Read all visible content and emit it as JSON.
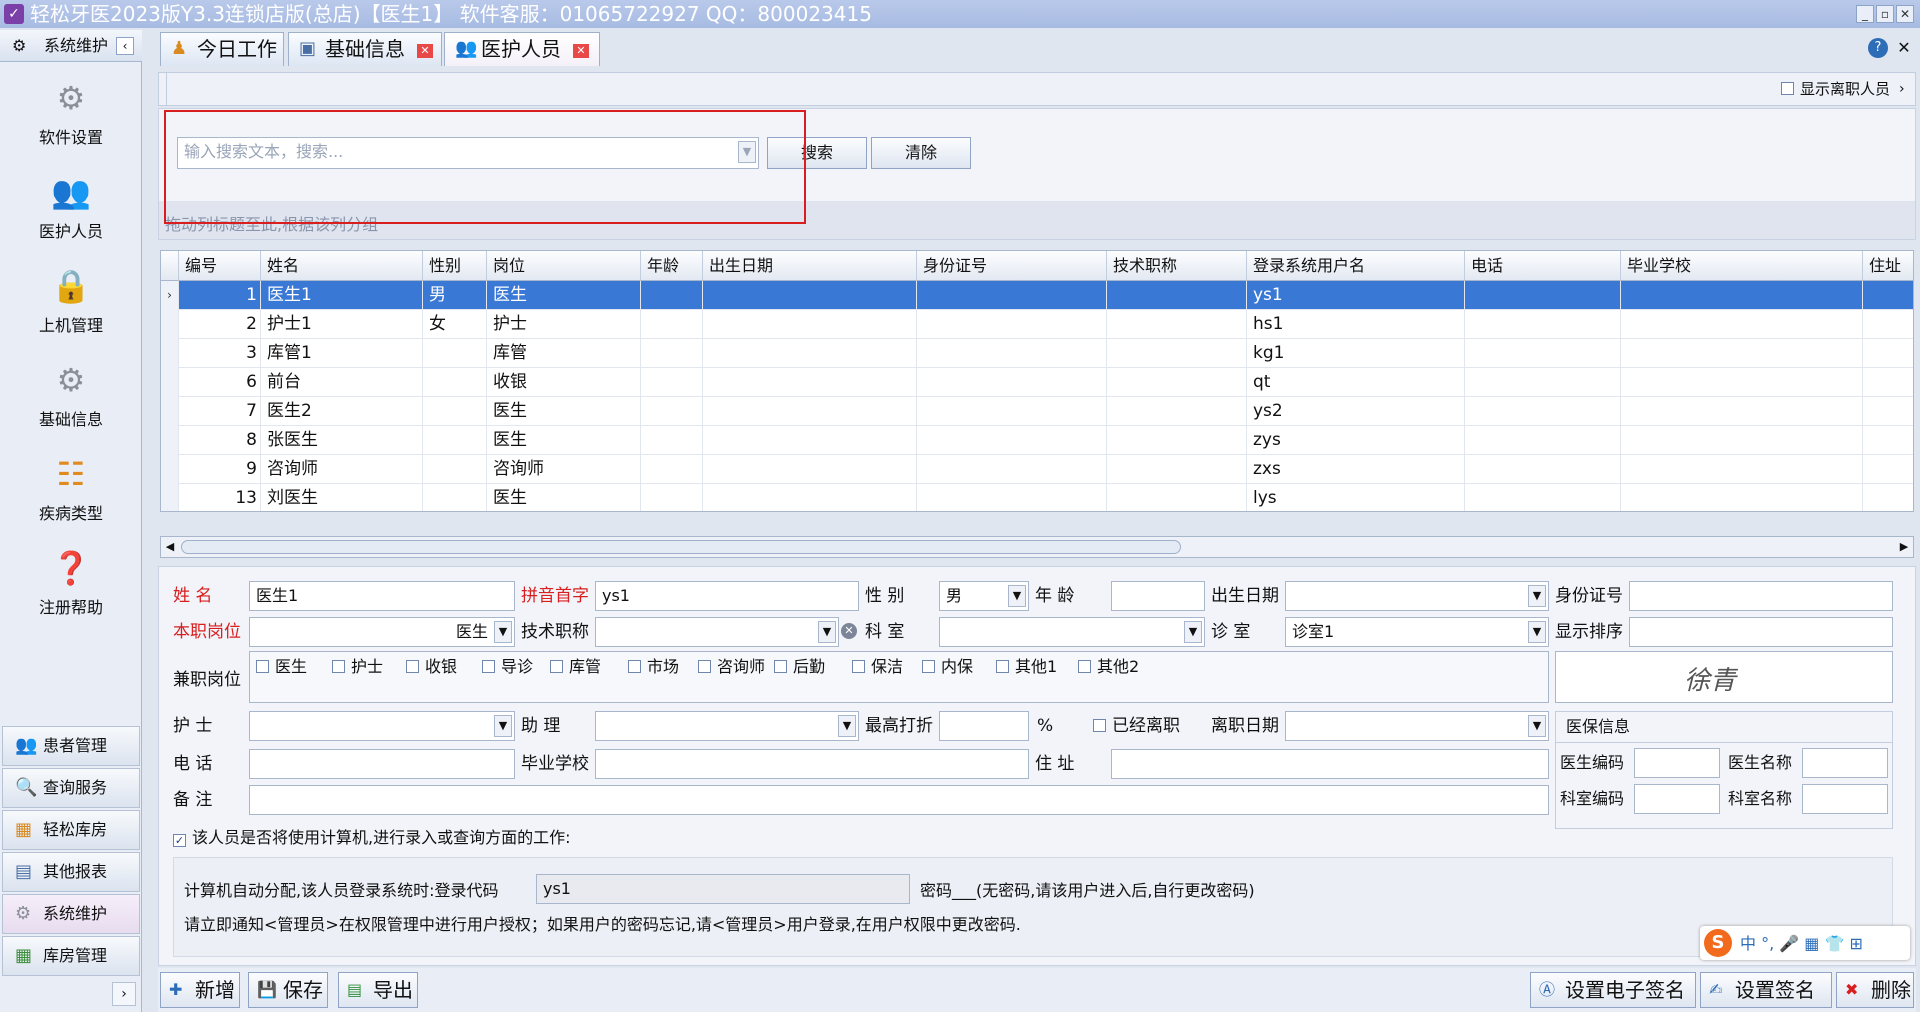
{
  "window": {
    "title": "轻松牙医2023版Y3.3连锁店版(总店)【医生1】    软件客服：01065722927 QQ：800023415"
  },
  "sidebar": {
    "header": "系统维护",
    "items": [
      {
        "label": "软件设置",
        "icon": "gear-icon"
      },
      {
        "label": "医护人员",
        "icon": "staff-icon"
      },
      {
        "label": "上机管理",
        "icon": "lock-icon"
      },
      {
        "label": "基础信息",
        "icon": "document-gear-icon"
      },
      {
        "label": "疾病类型",
        "icon": "tree-icon"
      },
      {
        "label": "注册帮助",
        "icon": "help-icon"
      }
    ],
    "nav": [
      {
        "label": "患者管理"
      },
      {
        "label": "查询服务"
      },
      {
        "label": "轻松库房"
      },
      {
        "label": "其他报表"
      },
      {
        "label": "系统维护"
      },
      {
        "label": "库房管理"
      }
    ]
  },
  "tabs": [
    {
      "label": "今日工作"
    },
    {
      "label": "基础信息"
    },
    {
      "label": "医护人员"
    }
  ],
  "toolbar": {
    "show_resigned": "显示离职人员"
  },
  "search": {
    "placeholder": "输入搜索文本，搜索...",
    "search_label": "搜索",
    "clear_label": "清除",
    "group_hint": "拖动列标题至此,根据该列分组"
  },
  "grid": {
    "columns": [
      "编号",
      "姓名",
      "性别",
      "岗位",
      "年龄",
      "出生日期",
      "身份证号",
      "技术职称",
      "登录系统用户名",
      "电话",
      "毕业学校",
      "住址"
    ],
    "rows": [
      {
        "id": "1",
        "name": "医生1",
        "gender": "男",
        "post": "医生",
        "login": "ys1"
      },
      {
        "id": "2",
        "name": "护士1",
        "gender": "女",
        "post": "护士",
        "login": "hs1"
      },
      {
        "id": "3",
        "name": "库管1",
        "gender": "",
        "post": "库管",
        "login": "kg1"
      },
      {
        "id": "6",
        "name": "前台",
        "gender": "",
        "post": "收银",
        "login": "qt"
      },
      {
        "id": "7",
        "name": "医生2",
        "gender": "",
        "post": "医生",
        "login": "ys2"
      },
      {
        "id": "8",
        "name": "张医生",
        "gender": "",
        "post": "医生",
        "login": "zys"
      },
      {
        "id": "9",
        "name": "咨询师",
        "gender": "",
        "post": "咨询师",
        "login": "zxs"
      },
      {
        "id": "13",
        "name": "刘医生",
        "gender": "",
        "post": "医生",
        "login": "lys"
      }
    ]
  },
  "form": {
    "name_label": "姓  名",
    "name_value": "医生1",
    "pinyin_label": "拼音首字",
    "pinyin_value": "ys1",
    "gender_label": "性  别",
    "gender_value": "男",
    "age_label": "年  龄",
    "birth_label": "出生日期",
    "idcard_label": "身份证号",
    "post_label": "本职岗位",
    "post_value": "医生",
    "title_label": "技术职称",
    "dept_label": "科  室",
    "room_label": "诊  室",
    "room_value": "诊室1",
    "order_label": "显示排序",
    "parttime_label": "兼职岗位",
    "parttime_options": [
      "医生",
      "护士",
      "收银",
      "导诊",
      "库管",
      "市场",
      "咨询师",
      "后勤",
      "保洁",
      "内保",
      "其他1",
      "其他2"
    ],
    "signature": "徐青",
    "nurse_label": "护  士",
    "assistant_label": "助  理",
    "discount_label": "最高打折",
    "percent": "%",
    "resigned_label": "已经离职",
    "resign_date_label": "离职日期",
    "insurance_label": "医保信息",
    "phone_label": "电  话",
    "school_label": "毕业学校",
    "address_label": "住  址",
    "doctor_code_label": "医生编码",
    "doctor_name_label": "医生名称",
    "dept_code_label": "科室编码",
    "dept_name_label": "科室名称",
    "remark_label": "备  注",
    "use_computer_label": "该人员是否将使用计算机,进行录入或查询方面的工作:",
    "login_line": "计算机自动分配,该人员登录系统时:登录代码",
    "login_code": "ys1",
    "password_line": "密码___(无密码,请该用户进入后,自行更改密码)",
    "notice_line": "请立即通知<管理员>在权限管理中进行用户授权；如果用户的密码忘记,请<管理员>用户登录,在用户权限中更改密码."
  },
  "bottom": {
    "add": "新增",
    "save": "保存",
    "export": "导出",
    "set_esign": "设置电子签名",
    "set_sign": "设置签名",
    "delete": "删除"
  }
}
